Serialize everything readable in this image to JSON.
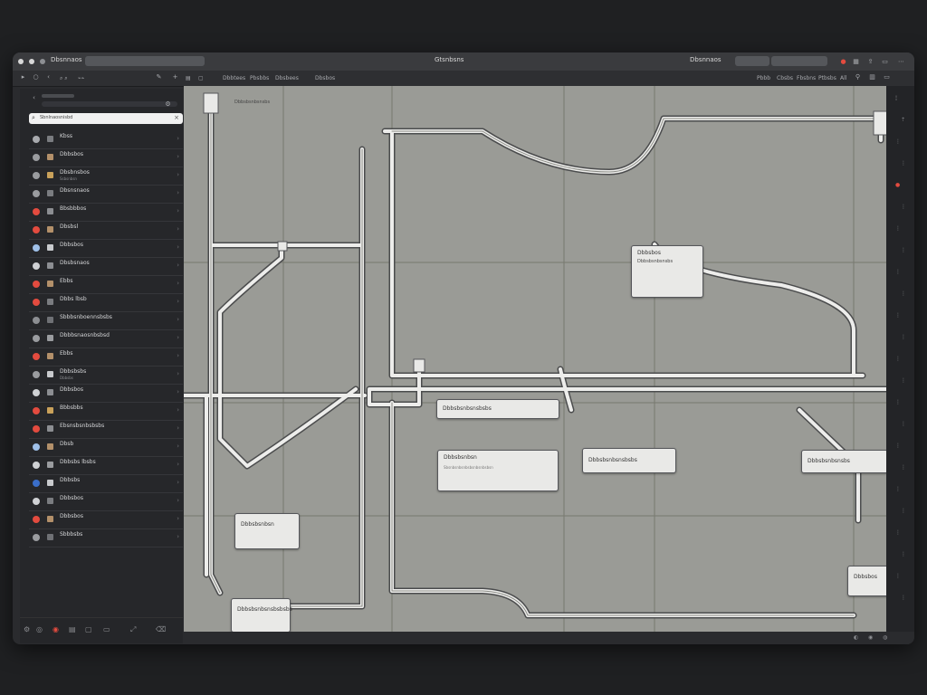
{
  "titlebar": {
    "left_label": "Dbsnnaos",
    "title": "Gtsnbsns",
    "right_label": "Dbsnnaos"
  },
  "toolbar": {
    "left_items": [
      "Dbbtees",
      "Pbsbbs",
      "Dbsbees",
      "Dbsbos"
    ],
    "right_items": [
      "Pbbb",
      "Cbsbs",
      "Fbsbns",
      "Ptbsbs",
      "All"
    ]
  },
  "sidebar": {
    "search_placeholder": "Sbnlnaosnisbd",
    "items": [
      {
        "label": "Kbss",
        "sub": "",
        "color": "#a8aaae",
        "sq": "#7a7c80"
      },
      {
        "label": "Dbbsbos",
        "sub": "",
        "color": "#9a9c9f",
        "sq": "#b3906a"
      },
      {
        "label": "Dbsbnsbos",
        "sub": "Ssbsnbsn",
        "color": "#9a9c9f",
        "sq": "#c9a15a"
      },
      {
        "label": "Dbsnsnaos",
        "sub": "",
        "color": "#9a9c9f",
        "sq": "#7a7c80"
      },
      {
        "label": "Bbsbbbos",
        "sub": "",
        "color": "#e34b3f",
        "sq": "#8c8e92"
      },
      {
        "label": "Dbsbsl",
        "sub": "",
        "color": "#e34b3f",
        "sq": "#b3906a"
      },
      {
        "label": "Dbbsbos",
        "sub": "",
        "color": "#9fc0e8",
        "sq": "#c8cacd"
      },
      {
        "label": "Dbsbsnaos",
        "sub": "",
        "color": "#cfd1d4",
        "sq": "#8c8e92"
      },
      {
        "label": "Ebbs",
        "sub": "",
        "color": "#e34b3f",
        "sq": "#b3906a"
      },
      {
        "label": "Dbbs lbsb",
        "sub": "",
        "color": "#e34b3f",
        "sq": "#7a7c80"
      },
      {
        "label": "Sbbbsnboennsbsbs",
        "sub": "",
        "color": "#8c8e92",
        "sq": "#6f7175"
      },
      {
        "label": "Dbbbsnaosnbsbsd",
        "sub": "",
        "color": "#9a9c9f",
        "sq": "#9a9c9f"
      },
      {
        "label": "Ebbs",
        "sub": "",
        "color": "#e34b3f",
        "sq": "#b3906a"
      },
      {
        "label": "Dbbsbsbs",
        "sub": "Dbbsbs",
        "color": "#9a9c9f",
        "sq": "#c8cacd"
      },
      {
        "label": "Dbbsbos",
        "sub": "",
        "color": "#cfd1d4",
        "sq": "#8c8e92"
      },
      {
        "label": "Bbbsbbs",
        "sub": "",
        "color": "#e34b3f",
        "sq": "#c9a15a"
      },
      {
        "label": "Ebsnsbsnbsbsbs",
        "sub": "",
        "color": "#e34b3f",
        "sq": "#8c8e92"
      },
      {
        "label": "Dbsb",
        "sub": "",
        "color": "#9fc0e8",
        "sq": "#b3906a"
      },
      {
        "label": "Dbbsbs lbsbs",
        "sub": "",
        "color": "#cfd1d4",
        "sq": "#9a9c9f"
      },
      {
        "label": "Dbbsbs",
        "sub": "",
        "color": "#3a6ec9",
        "sq": "#c8cacd"
      },
      {
        "label": "Dbbsbos",
        "sub": "",
        "color": "#cfd1d4",
        "sq": "#7a7c80"
      },
      {
        "label": "Dbbsbos",
        "sub": "",
        "color": "#e34b3f",
        "sq": "#b3906a"
      },
      {
        "label": "Sbbbsbs",
        "sub": "",
        "color": "#9a9c9f",
        "sq": "#6f7175"
      }
    ]
  },
  "nodes": [
    {
      "id": "header",
      "title": "Dbbsbsnbsnsbs",
      "desc": ""
    },
    {
      "id": "n1",
      "title": "Dbbsbos",
      "desc": "Dbbsbsnbsnsbs"
    },
    {
      "id": "n2",
      "title": "Dbbsbsnbsnsbsbs",
      "desc": ""
    },
    {
      "id": "n3",
      "title": "Dbbsbsnbsn",
      "desc": "Sbsnbsnbsnbsbsnbsnbsbsn"
    },
    {
      "id": "n4",
      "title": "Dbbsbsnbsnsbsbs",
      "desc": ""
    },
    {
      "id": "n5",
      "title": "Dbbsbsnbsnsbs",
      "desc": ""
    },
    {
      "id": "n6",
      "title": "Dbbsbsnbsn",
      "desc": ""
    },
    {
      "id": "n7",
      "title": "Dbbsbsnbsnsbsbsbs",
      "desc": ""
    },
    {
      "id": "n8",
      "title": "Dbbsbos",
      "desc": ""
    }
  ]
}
